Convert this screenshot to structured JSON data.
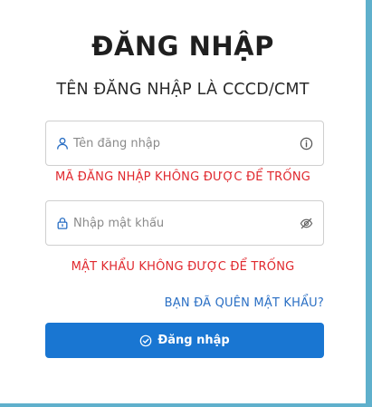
{
  "login": {
    "title": "ĐĂNG NHẬP",
    "subtitle": "TÊN ĐĂNG NHẬP LÀ CCCD/CMT",
    "username": {
      "value": "",
      "placeholder": "Tên đăng nhập",
      "error": "MÃ ĐĂNG NHẬP KHÔNG ĐƯỢC ĐỂ TRỐNG"
    },
    "password": {
      "value": "",
      "placeholder": "Nhập mật khẩu",
      "error": "MẬT KHẨU KHÔNG ĐƯỢC ĐỂ TRỐNG"
    },
    "forgot_label": "BẠN ĐÃ QUÊN MẬT KHẨU?",
    "submit_label": "Đăng nhập"
  },
  "icons": {
    "username": "user-icon",
    "username_trailing": "info-circle-icon",
    "password": "lock-icon",
    "password_trailing": "eye-slash-icon",
    "submit": "check-circle-icon"
  },
  "colors": {
    "background": "#5fb0cc",
    "error": "#e0282e",
    "link": "#2a6fc4",
    "primary_button": "#1976d2"
  }
}
